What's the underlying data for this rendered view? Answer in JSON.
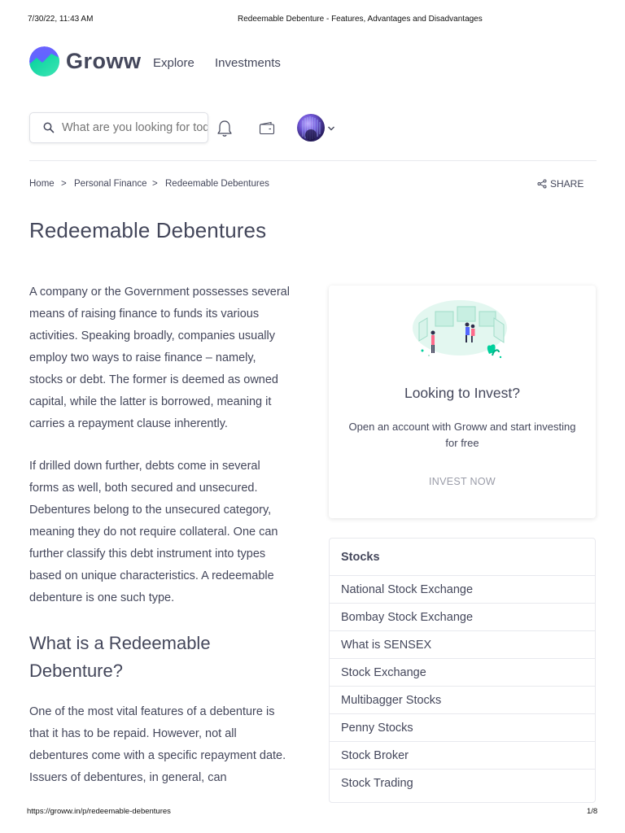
{
  "print_header": {
    "date": "7/30/22, 11:43 AM",
    "title": "Redeemable Debenture - Features, Advantages and Disadvantages"
  },
  "print_footer": {
    "url": "https://groww.in/p/redeemable-debentures",
    "page": "1/8"
  },
  "brand": {
    "name": "Groww",
    "logo_icon": "groww-logo-icon",
    "colors": {
      "logo_top": "#5367ff",
      "logo_bottom": "#00d09c"
    }
  },
  "nav": {
    "items": [
      {
        "label": "Explore"
      },
      {
        "label": "Investments"
      }
    ]
  },
  "search": {
    "placeholder": "What are you looking for today?",
    "value": "",
    "icon": "search-icon"
  },
  "header_icons": [
    "bell-icon",
    "wallet-icon",
    "avatar",
    "chevron-down-icon"
  ],
  "breadcrumb": {
    "items": [
      "Home",
      "Personal Finance",
      "Redeemable Debentures"
    ],
    "separator": ">"
  },
  "share": {
    "label": "SHARE",
    "icon": "share-icon"
  },
  "page_title": "Redeemable Debentures",
  "article": {
    "paragraphs": [
      "A company or the Government possesses several means of raising finance to funds its various activities. Speaking broadly, companies usually employ two ways to raise finance – namely, stocks or debt. The former is deemed as owned capital, while the latter is borrowed, meaning it carries a repayment clause inherently.",
      "If drilled down further, debts come in several forms as well, both secured and unsecured. Debentures belong to the unsecured category, meaning they do not require collateral. One can further classify this debt instrument into types based on unique characteristics. A redeemable debenture is one such type."
    ],
    "section_heading": "What is a Redeemable Debenture?",
    "section_paragraph": "One of the most vital features of a debenture is that it has to be repaid. However, not all debentures come with a specific repayment date. Issuers of debentures, in general, can"
  },
  "invest_card": {
    "heading": "Looking to Invest?",
    "description": "Open an account with Groww and start investing for free",
    "button_label": "INVEST NOW",
    "accent": "#00d09c"
  },
  "stocks_card": {
    "header": "Stocks",
    "items": [
      "National Stock Exchange",
      "Bombay Stock Exchange",
      "What is SENSEX",
      "Stock Exchange",
      "Multibagger Stocks",
      "Penny Stocks",
      "Stock Broker",
      "Stock Trading"
    ]
  }
}
